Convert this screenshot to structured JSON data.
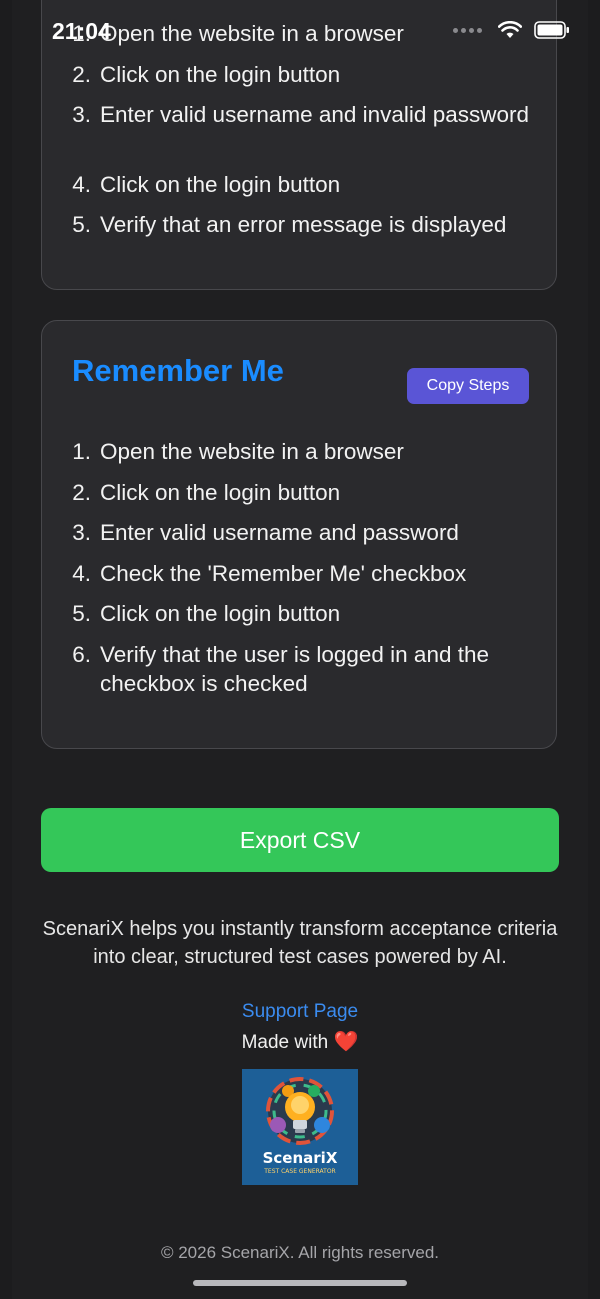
{
  "status_bar": {
    "time": "21:04"
  },
  "card_1": {
    "steps": [
      {
        "num": "1.",
        "text": "Open the website in a browser"
      },
      {
        "num": "2.",
        "text": "Click on the login button"
      },
      {
        "num": "3.",
        "text": "Enter valid username and invalid password"
      },
      {
        "num": "4.",
        "text": "Click on the login button"
      },
      {
        "num": "5.",
        "text": "Verify that an error message is displayed"
      }
    ]
  },
  "card_2": {
    "title": "Remember Me",
    "copy_label": "Copy Steps",
    "steps": [
      {
        "num": "1.",
        "text": "Open the website in a browser"
      },
      {
        "num": "2.",
        "text": "Click on the login button"
      },
      {
        "num": "3.",
        "text": "Enter valid username and password"
      },
      {
        "num": "4.",
        "text": "Check the 'Remember Me' checkbox"
      },
      {
        "num": "5.",
        "text": "Click on the login button"
      },
      {
        "num": "6.",
        "text": "Verify that the user is logged in and the checkbox is checked"
      }
    ]
  },
  "export_label": "Export CSV",
  "footer": {
    "about": "ScenariX helps you instantly transform acceptance criteria into clear, structured test cases powered by AI.",
    "support_link": "Support Page",
    "made_with": "Made with",
    "heart": "❤️",
    "logo_name": "ScenariX",
    "logo_tagline": "TEST CASE GENERATOR",
    "copyright": "© 2026 ScenariX. All rights reserved."
  },
  "colors": {
    "accent_title": "#1a8cff",
    "copy_button": "#5a55d6",
    "export_button": "#34c759",
    "link": "#3b8cf0"
  }
}
